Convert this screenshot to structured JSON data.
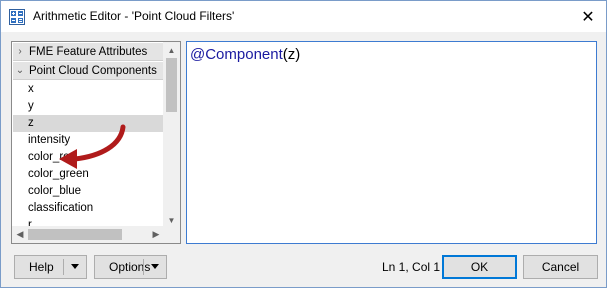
{
  "window": {
    "title": "Arithmetic Editor - 'Point Cloud Filters'",
    "close_glyph": "✕",
    "app_icon": "calculator-grid-icon"
  },
  "tree": {
    "categories": [
      {
        "label": "FME Feature Attributes",
        "expanded": false,
        "chevron": "›"
      },
      {
        "label": "Point Cloud Components",
        "expanded": true,
        "chevron": "⌄"
      }
    ],
    "items": [
      "x",
      "y",
      "z",
      "intensity",
      "color_red",
      "color_green",
      "color_blue",
      "classification",
      "r"
    ],
    "selected_item": "z",
    "scroll": {
      "up": "▲",
      "down": "▼",
      "left": "◀",
      "right": "▶"
    }
  },
  "editor": {
    "function_name": "@Component",
    "open_paren": "(",
    "argument": "z",
    "close_paren": ")"
  },
  "footer": {
    "help_label": "Help",
    "options_label": "Options",
    "status": "Ln 1, Col 1",
    "ok_label": "OK",
    "cancel_label": "Cancel"
  },
  "colors": {
    "accent": "#0078d7",
    "arrow": "#b01b1b",
    "selection": "#d9d9d9"
  }
}
